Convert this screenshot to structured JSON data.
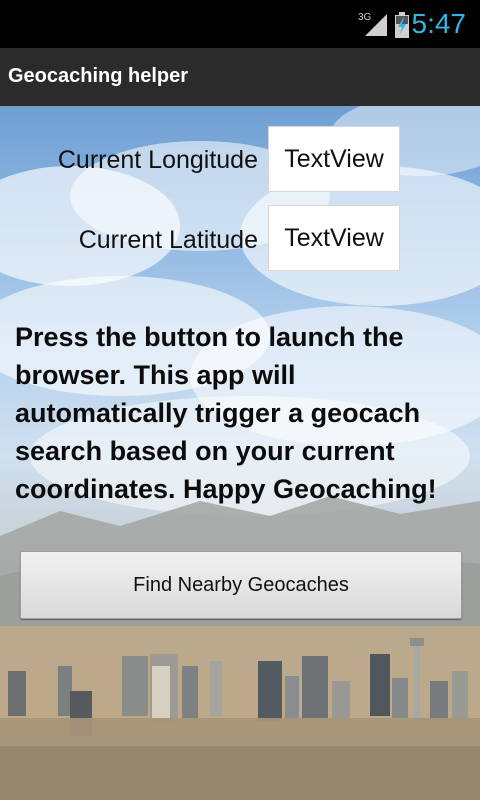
{
  "status_bar": {
    "network": "3G",
    "time": "5:47"
  },
  "action_bar": {
    "title": "Geocaching helper"
  },
  "location": {
    "longitude_label": "Current Longitude",
    "longitude_value": "TextView",
    "latitude_label": "Current Latitude",
    "latitude_value": "TextView"
  },
  "instructions": "Press the button to launch the browser. This app will automatically trigger a geocach search based on your current coordinates. Happy Geocaching!",
  "find_button_label": "Find Nearby Geocaches",
  "colors": {
    "accent": "#33b5e5",
    "action_bar": "#2b2b2b",
    "sky": "#8fb8e2"
  }
}
